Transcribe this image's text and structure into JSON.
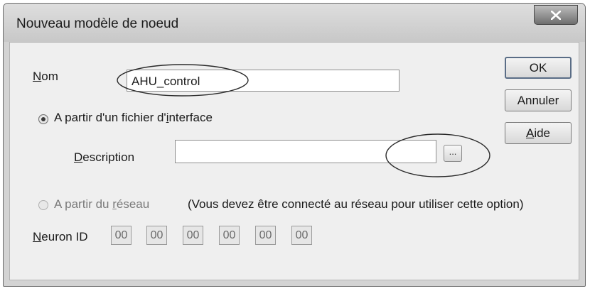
{
  "window": {
    "title": "Nouveau modèle de noeud"
  },
  "form": {
    "name_label_mnemonic": "N",
    "name_label_rest": "om",
    "name_value": "AHU_control",
    "radio_interface_pre": "A partir d'un fichier d'",
    "radio_interface_mnemonic": "i",
    "radio_interface_post": "nterface",
    "radio_interface_selected": true,
    "description_label_mnemonic": "D",
    "description_label_rest": "escription",
    "description_value": "",
    "browse_label": "...",
    "radio_network_pre": "A partir du ",
    "radio_network_mnemonic": "r",
    "radio_network_post": "éseau",
    "radio_network_selected": false,
    "network_note": "(Vous devez être connecté au réseau pour utiliser cette option)",
    "neuron_label_mnemonic": "N",
    "neuron_label_rest": "euron ID",
    "neuron_id": [
      "00",
      "00",
      "00",
      "00",
      "00",
      "00"
    ]
  },
  "buttons": {
    "ok": "OK",
    "cancel": "Annuler",
    "help_mnemonic": "A",
    "help_rest": "ide"
  },
  "colors": {
    "window_bg": "#d3d3d3",
    "client_bg": "#efefef",
    "annotation": "#2a2a2a"
  }
}
